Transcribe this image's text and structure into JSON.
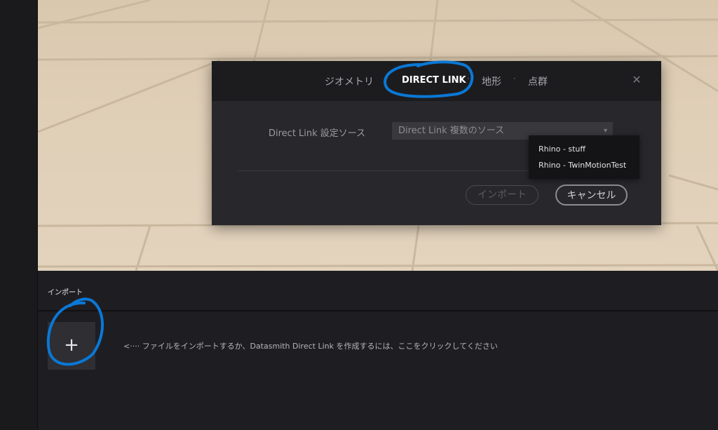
{
  "dialog": {
    "tabs": [
      {
        "label": "ジオメトリ"
      },
      {
        "label": "DIRECT LINK"
      },
      {
        "label": "地形"
      },
      {
        "label": "点群"
      }
    ],
    "tab_separator": "·",
    "close_glyph": "✕",
    "source_label": "Direct Link 設定ソース",
    "source_value": "Direct Link 複数のソース",
    "select_arrow": "▾",
    "import_button": "インポート",
    "cancel_button": "キャンセル"
  },
  "dropdown": {
    "items": [
      "Rhino - stuff",
      "Rhino - TwinMotionTest"
    ]
  },
  "import_panel": {
    "title": "インポート",
    "add_glyph": "+",
    "hint": "<····  ファイルをインポートするか、Datasmith Direct Link を作成するには、ここをクリックしてください"
  },
  "icons": {
    "close": "close-icon",
    "add": "plus-icon",
    "arrow": "chevron-down-icon"
  },
  "colors": {
    "annotation": "#0a78d6",
    "dialog_bg": "#28282c",
    "floor": "#e0cfb7"
  }
}
